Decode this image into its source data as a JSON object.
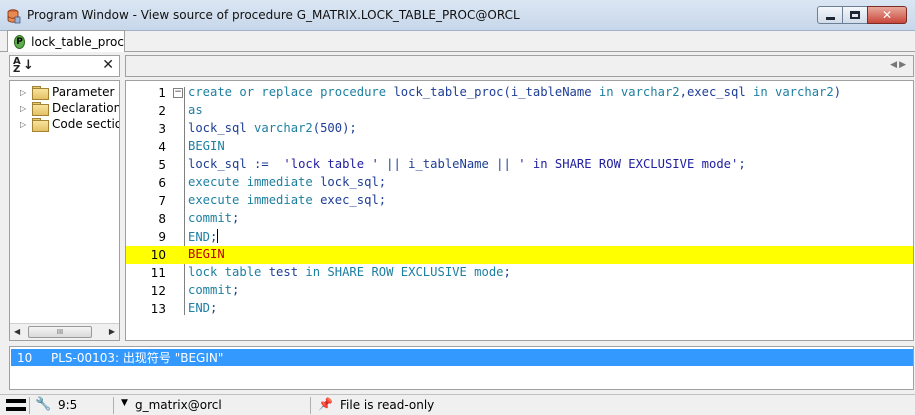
{
  "window": {
    "title": "Program Window - View source of procedure G_MATRIX.LOCK_TABLE_PROC@ORCL",
    "icon": "database-icon"
  },
  "tabs": [
    {
      "label": "lock_table_proc",
      "icon": "P",
      "active": true
    }
  ],
  "tree": {
    "items": [
      {
        "label": "Parameter list"
      },
      {
        "label": "Declaration"
      },
      {
        "label": "Code sections"
      }
    ],
    "scrollbar_grip": "III"
  },
  "editor": {
    "lines": [
      {
        "n": "1",
        "segments": [
          {
            "t": "create or replace procedure ",
            "c": "kw"
          },
          {
            "t": "lock_table_proc(i_tableName ",
            "c": "txt"
          },
          {
            "t": "in varchar2",
            "c": "kw"
          },
          {
            "t": ",exec_sql ",
            "c": "txt"
          },
          {
            "t": "in varchar2",
            "c": "kw"
          },
          {
            "t": ")",
            "c": "txt"
          }
        ]
      },
      {
        "n": "2",
        "segments": [
          {
            "t": "as",
            "c": "kw"
          }
        ]
      },
      {
        "n": "3",
        "segments": [
          {
            "t": "lock_sql ",
            "c": "txt"
          },
          {
            "t": "varchar2",
            "c": "kw"
          },
          {
            "t": "(500);",
            "c": "txt"
          }
        ]
      },
      {
        "n": "4",
        "segments": [
          {
            "t": "BEGIN",
            "c": "kw"
          }
        ]
      },
      {
        "n": "5",
        "segments": [
          {
            "t": "lock_sql :=  ",
            "c": "txt"
          },
          {
            "t": "'lock table '",
            "c": "str"
          },
          {
            "t": " || i_tableName || ",
            "c": "txt"
          },
          {
            "t": "' in SHARE ROW EXCLUSIVE mode'",
            "c": "str"
          },
          {
            "t": ";",
            "c": "txt"
          }
        ]
      },
      {
        "n": "6",
        "segments": [
          {
            "t": "execute immediate ",
            "c": "kw"
          },
          {
            "t": "lock_sql;",
            "c": "txt"
          }
        ]
      },
      {
        "n": "7",
        "segments": [
          {
            "t": "execute immediate ",
            "c": "kw"
          },
          {
            "t": "exec_sql;",
            "c": "txt"
          }
        ]
      },
      {
        "n": "8",
        "segments": [
          {
            "t": "commit",
            "c": "kw"
          },
          {
            "t": ";",
            "c": "txt"
          }
        ]
      },
      {
        "n": "9",
        "segments": [
          {
            "t": "END",
            "c": "kw"
          },
          {
            "t": ";",
            "c": "txt"
          }
        ],
        "caret": true
      },
      {
        "n": "10",
        "segments": [
          {
            "t": "BEGIN",
            "c": "err"
          }
        ],
        "highlight": true
      },
      {
        "n": "11",
        "segments": [
          {
            "t": "lock table ",
            "c": "kw"
          },
          {
            "t": "test ",
            "c": "txt"
          },
          {
            "t": "in SHARE ROW EXCLUSIVE mode",
            "c": "kw"
          },
          {
            "t": ";",
            "c": "txt"
          }
        ]
      },
      {
        "n": "12",
        "segments": [
          {
            "t": "commit",
            "c": "kw"
          },
          {
            "t": ";",
            "c": "txt"
          }
        ]
      },
      {
        "n": "13",
        "segments": [
          {
            "t": "END",
            "c": "kw"
          },
          {
            "t": ";",
            "c": "txt"
          }
        ]
      }
    ],
    "fold_symbol": "−"
  },
  "messages": [
    {
      "line": "10",
      "text": "PLS-00103: 出现符号 \"BEGIN\""
    }
  ],
  "status": {
    "position": "9:5",
    "connection": "g_matrix@orcl",
    "readonly": "File is read-only"
  },
  "colors": {
    "keyword": "#1e7fa0",
    "identifier": "#1e3e96",
    "error_line": "#ffff00",
    "selection": "#3399ff"
  }
}
